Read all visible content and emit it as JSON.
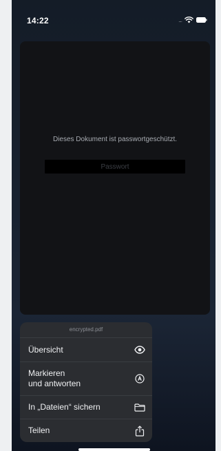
{
  "status_bar": {
    "time": "14:22",
    "signal_dots": "....",
    "icons": [
      "wifi-icon",
      "battery-icon"
    ]
  },
  "document": {
    "message": "Dieses Dokument ist passwortgeschützt.",
    "password_placeholder": "Passwort"
  },
  "action_sheet": {
    "title": "encrypted.pdf",
    "items": [
      {
        "label": "Übersicht",
        "icon": "eye-icon"
      },
      {
        "label": "Markieren\nund antworten",
        "icon": "markup-pen-icon"
      },
      {
        "label": "In „Dateien“ sichern",
        "icon": "folder-icon"
      },
      {
        "label": "Teilen",
        "icon": "share-icon"
      }
    ]
  },
  "colors": {
    "sheet_background": "#2b2d31",
    "card_background": "#121316",
    "text_primary": "#f0f1f3"
  }
}
